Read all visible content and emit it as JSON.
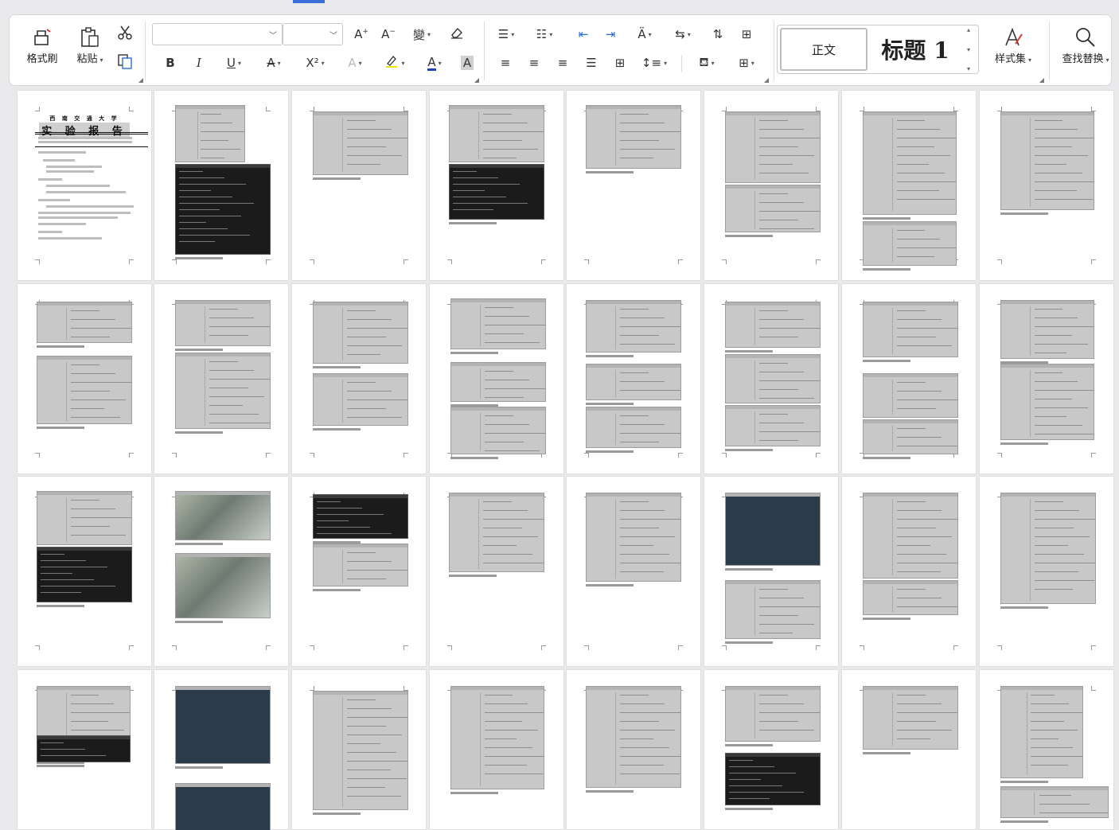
{
  "ribbon": {
    "clipboard": {
      "format_painter": "格式刷",
      "paste": "粘贴"
    },
    "styles": {
      "normal": "正文",
      "heading1": "标题 1",
      "style_set": "样式集"
    },
    "editing": {
      "find_replace": "查找替换"
    },
    "font": {
      "bold": "B",
      "italic": "I",
      "underline": "U",
      "strike": "A",
      "superscript": "X²",
      "text_effect": "A",
      "font_color": "A",
      "char_shading": "A"
    }
  },
  "document": {
    "cover_title_small": "西 南 交 通 大 学",
    "cover_title_main": "实 验 报 告",
    "page_count": 32
  },
  "colors": {
    "accent": "#3a6fd8",
    "font_color_underline": "#1f3fbf",
    "highlight": "#e8e800"
  }
}
